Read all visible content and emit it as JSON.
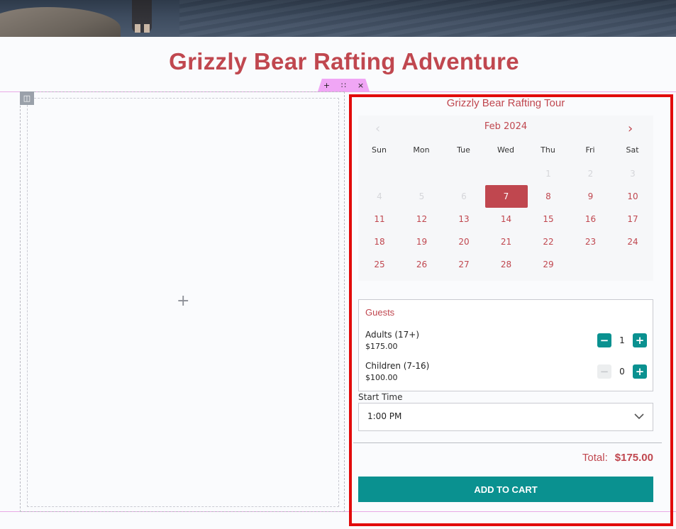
{
  "page": {
    "title": "Grizzly Bear Rafting Adventure"
  },
  "builder": {
    "toolbar_add": "+",
    "toolbar_move": "∷",
    "toolbar_close": "×",
    "column_handle": "◫",
    "add_block": "+"
  },
  "booking": {
    "tour_title": "Grizzly Bear Rafting Tour",
    "calendar": {
      "month_label": "Feb 2024",
      "prev_icon": "‹",
      "next_icon": "›",
      "weekdays": [
        "Sun",
        "Mon",
        "Tue",
        "Wed",
        "Thu",
        "Fri",
        "Sat"
      ],
      "weeks": [
        [
          {
            "d": ""
          },
          {
            "d": ""
          },
          {
            "d": ""
          },
          {
            "d": ""
          },
          {
            "d": "1",
            "state": "disabled"
          },
          {
            "d": "2",
            "state": "disabled"
          },
          {
            "d": "3",
            "state": "disabled"
          }
        ],
        [
          {
            "d": "4",
            "state": "disabled"
          },
          {
            "d": "5",
            "state": "disabled"
          },
          {
            "d": "6",
            "state": "disabled"
          },
          {
            "d": "7",
            "state": "selected"
          },
          {
            "d": "8"
          },
          {
            "d": "9"
          },
          {
            "d": "10"
          }
        ],
        [
          {
            "d": "11"
          },
          {
            "d": "12"
          },
          {
            "d": "13"
          },
          {
            "d": "14"
          },
          {
            "d": "15"
          },
          {
            "d": "16"
          },
          {
            "d": "17"
          }
        ],
        [
          {
            "d": "18"
          },
          {
            "d": "19"
          },
          {
            "d": "20"
          },
          {
            "d": "21"
          },
          {
            "d": "22"
          },
          {
            "d": "23"
          },
          {
            "d": "24"
          }
        ],
        [
          {
            "d": "25"
          },
          {
            "d": "26"
          },
          {
            "d": "27"
          },
          {
            "d": "28"
          },
          {
            "d": "29"
          },
          {
            "d": ""
          },
          {
            "d": ""
          }
        ]
      ]
    },
    "guests": {
      "title": "Guests",
      "rows": [
        {
          "label": "Adults (17+)",
          "price": "$175.00",
          "qty": "1",
          "minus": "−",
          "plus": "+",
          "minus_enabled": true
        },
        {
          "label": "Children (7-16)",
          "price": "$100.00",
          "qty": "0",
          "minus": "−",
          "plus": "+",
          "minus_enabled": false
        }
      ]
    },
    "start_time": {
      "label": "Start Time",
      "value": "1:00 PM"
    },
    "total_label": "Total:",
    "total_value": "$175.00",
    "add_to_cart": "ADD TO CART"
  },
  "colors": {
    "accent": "#c0474f",
    "teal": "#0a9190",
    "highlight_frame": "#e20b0b"
  }
}
